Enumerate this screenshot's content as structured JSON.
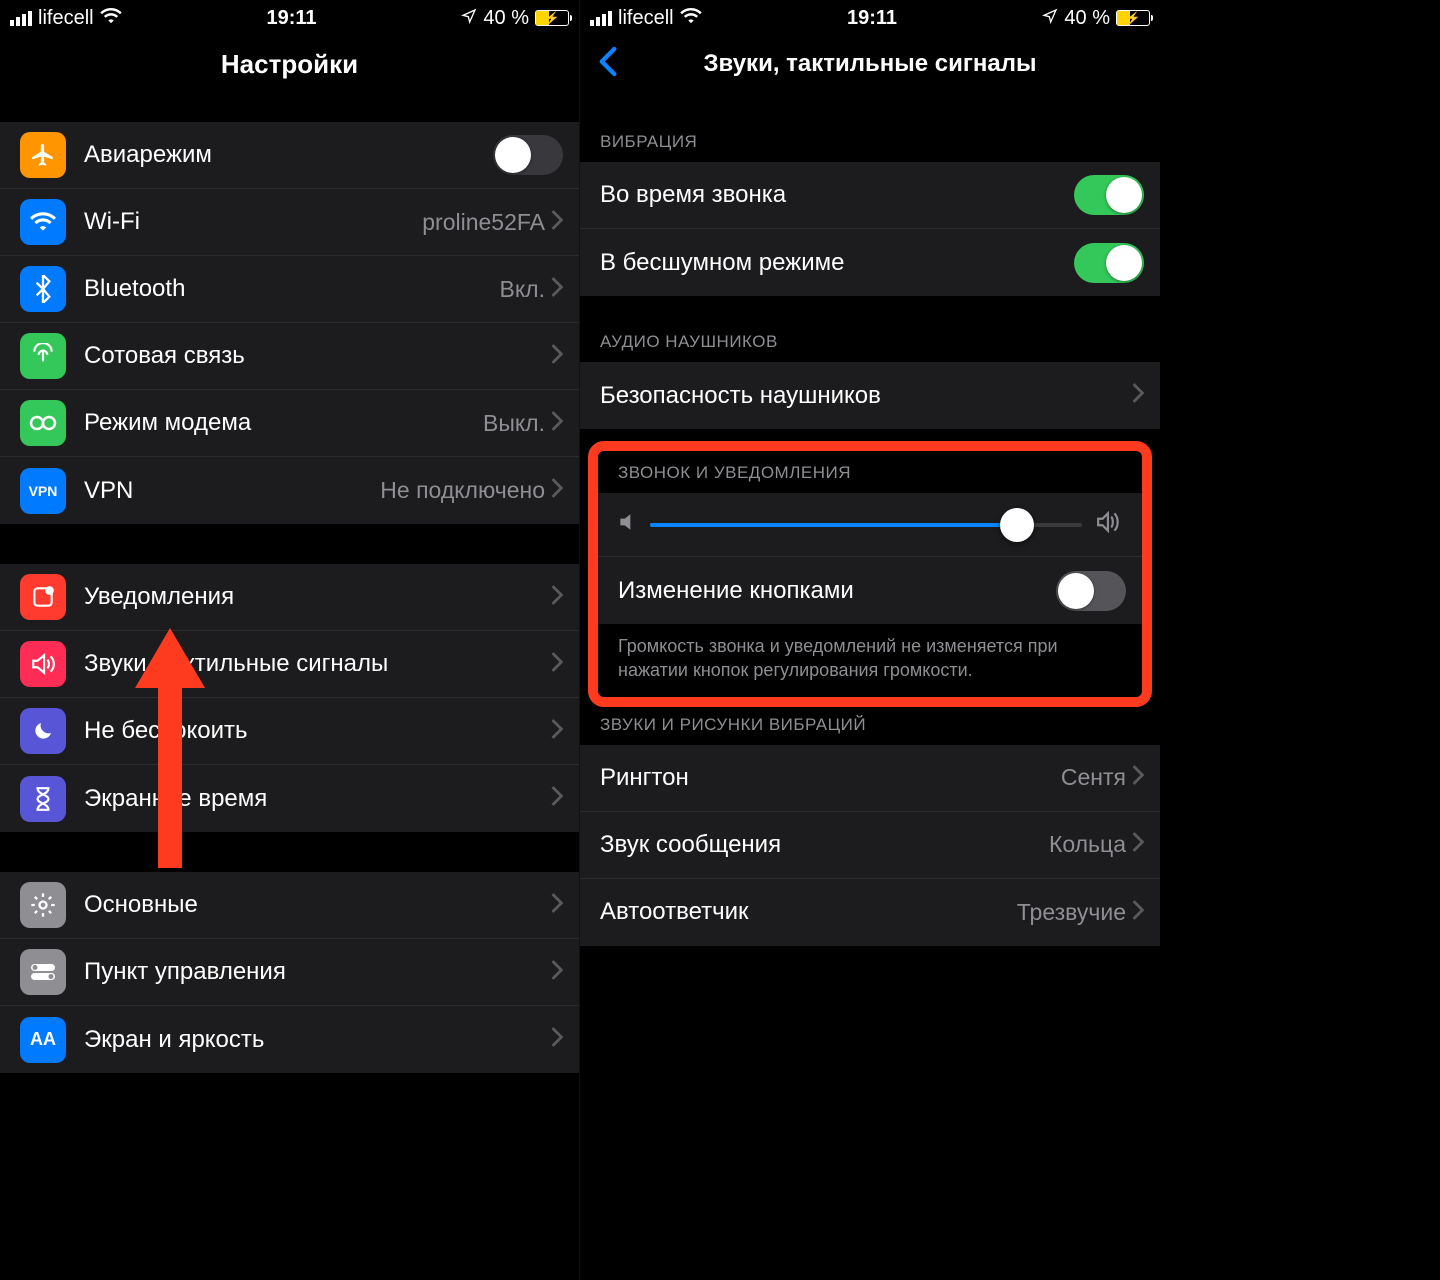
{
  "statusbar": {
    "carrier": "lifecell",
    "time": "19:11",
    "batteryText": "40 %",
    "batteryLevel": 40
  },
  "left": {
    "title": "Настройки",
    "group1": [
      {
        "icon": "airplane",
        "bg": "#ff9500",
        "label": "Авиарежим",
        "type": "toggle",
        "on": false
      },
      {
        "icon": "wifi",
        "bg": "#007aff",
        "label": "Wi-Fi",
        "value": "proline52FA",
        "type": "nav"
      },
      {
        "icon": "bluetooth",
        "bg": "#007aff",
        "label": "Bluetooth",
        "value": "Вкл.",
        "type": "nav"
      },
      {
        "icon": "cellular",
        "bg": "#34c759",
        "label": "Сотовая связь",
        "type": "nav"
      },
      {
        "icon": "hotspot",
        "bg": "#34c759",
        "label": "Режим модема",
        "value": "Выкл.",
        "type": "nav"
      },
      {
        "icon": "vpn",
        "bg": "#007aff",
        "label": "VPN",
        "value": "Не подключено",
        "type": "nav"
      }
    ],
    "group2": [
      {
        "icon": "notifications",
        "bg": "#ff3b30",
        "label": "Уведомления",
        "type": "nav"
      },
      {
        "icon": "sounds",
        "bg": "#ff2d55",
        "label": "Звуки, тактильные сигналы",
        "type": "nav"
      },
      {
        "icon": "dnd",
        "bg": "#5856d6",
        "label": "Не беспокоить",
        "type": "nav"
      },
      {
        "icon": "screentime",
        "bg": "#5856d6",
        "label": "Экранное время",
        "type": "nav"
      }
    ],
    "group3": [
      {
        "icon": "general",
        "bg": "#8e8e93",
        "label": "Основные",
        "type": "nav"
      },
      {
        "icon": "control",
        "bg": "#8e8e93",
        "label": "Пункт управления",
        "type": "nav"
      },
      {
        "icon": "display",
        "bg": "#007aff",
        "label": "Экран и яркость",
        "type": "nav"
      }
    ]
  },
  "right": {
    "title": "Звуки, тактильные сигналы",
    "vibrationHeader": "ВИБРАЦИЯ",
    "vibration": [
      {
        "label": "Во время звонка",
        "on": true
      },
      {
        "label": "В бесшумном режиме",
        "on": true
      }
    ],
    "headphoneHeader": "АУДИО НАУШНИКОВ",
    "headphone": [
      {
        "label": "Безопасность наушников",
        "type": "nav"
      }
    ],
    "ringerHeader": "ЗВОНОК И УВЕДОМЛЕНИЯ",
    "ringer": {
      "sliderPercent": 85,
      "buttonsLabel": "Изменение кнопками",
      "buttonsOn": false,
      "footer": "Громкость звонка и уведомлений не изменяется при нажатии кнопок регулирования громкости."
    },
    "patternsHeader": "ЗВУКИ И РИСУНКИ ВИБРАЦИЙ",
    "patterns": [
      {
        "label": "Рингтон",
        "value": "Сентя"
      },
      {
        "label": "Звук сообщения",
        "value": "Кольца"
      },
      {
        "label": "Автоответчик",
        "value": "Трезвучие"
      }
    ]
  }
}
